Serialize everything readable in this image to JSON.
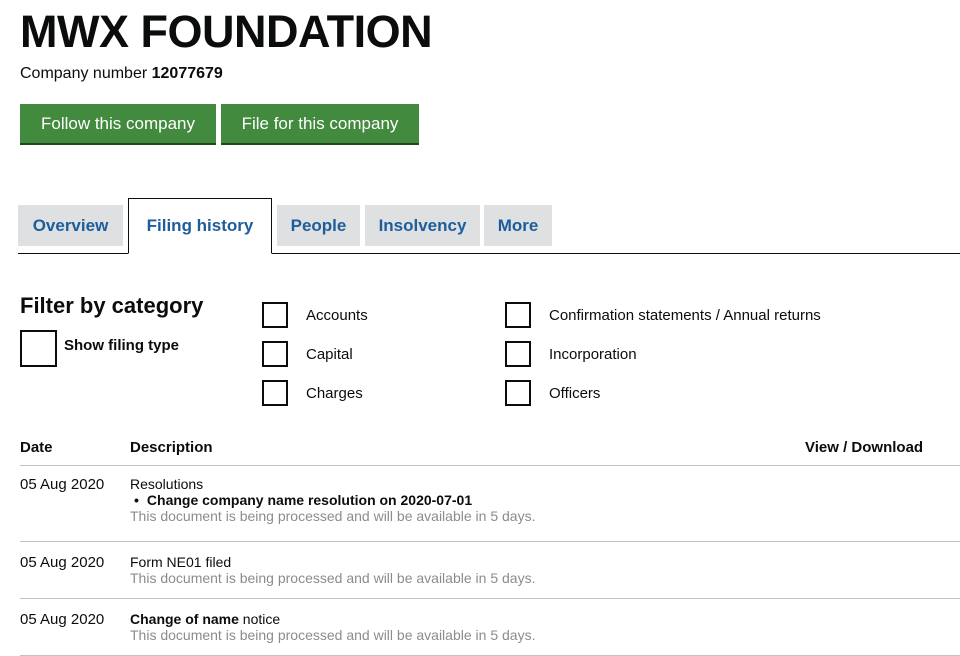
{
  "header": {
    "title": "MWX FOUNDATION",
    "company_number_label": "Company number",
    "company_number": "12077679"
  },
  "actions": {
    "follow_label": "Follow this company",
    "file_label": "File for this company",
    "button_color": "#428a3e"
  },
  "tabs": [
    {
      "label": "Overview",
      "active": false
    },
    {
      "label": "Filing history",
      "active": true
    },
    {
      "label": "People",
      "active": false
    },
    {
      "label": "Insolvency",
      "active": false
    },
    {
      "label": "More",
      "active": false
    }
  ],
  "filter": {
    "title": "Filter by category",
    "show_filing_type_label": "Show filing type",
    "categories": [
      {
        "label": "Accounts",
        "checked": false
      },
      {
        "label": "Capital",
        "checked": false
      },
      {
        "label": "Charges",
        "checked": false
      },
      {
        "label": "Confirmation statements / Annual returns",
        "checked": false
      },
      {
        "label": "Incorporation",
        "checked": false
      },
      {
        "label": "Officers",
        "checked": false
      }
    ]
  },
  "table": {
    "headers": {
      "date": "Date",
      "description": "Description",
      "view_download": "View / Download"
    },
    "rows": [
      {
        "date": "05 Aug 2020",
        "description": "Resolutions",
        "bullet": "Change company name resolution on 2020-07-01",
        "status": "This document is being processed and will be available in 5 days."
      },
      {
        "date": "05 Aug 2020",
        "description": "Form NE01 filed",
        "status": "This document is being processed and will be available in 5 days."
      },
      {
        "date": "05 Aug 2020",
        "description_bold": "Change of name",
        "description_rest": " notice",
        "status": "This document is being processed and will be available in 5 days."
      }
    ]
  }
}
